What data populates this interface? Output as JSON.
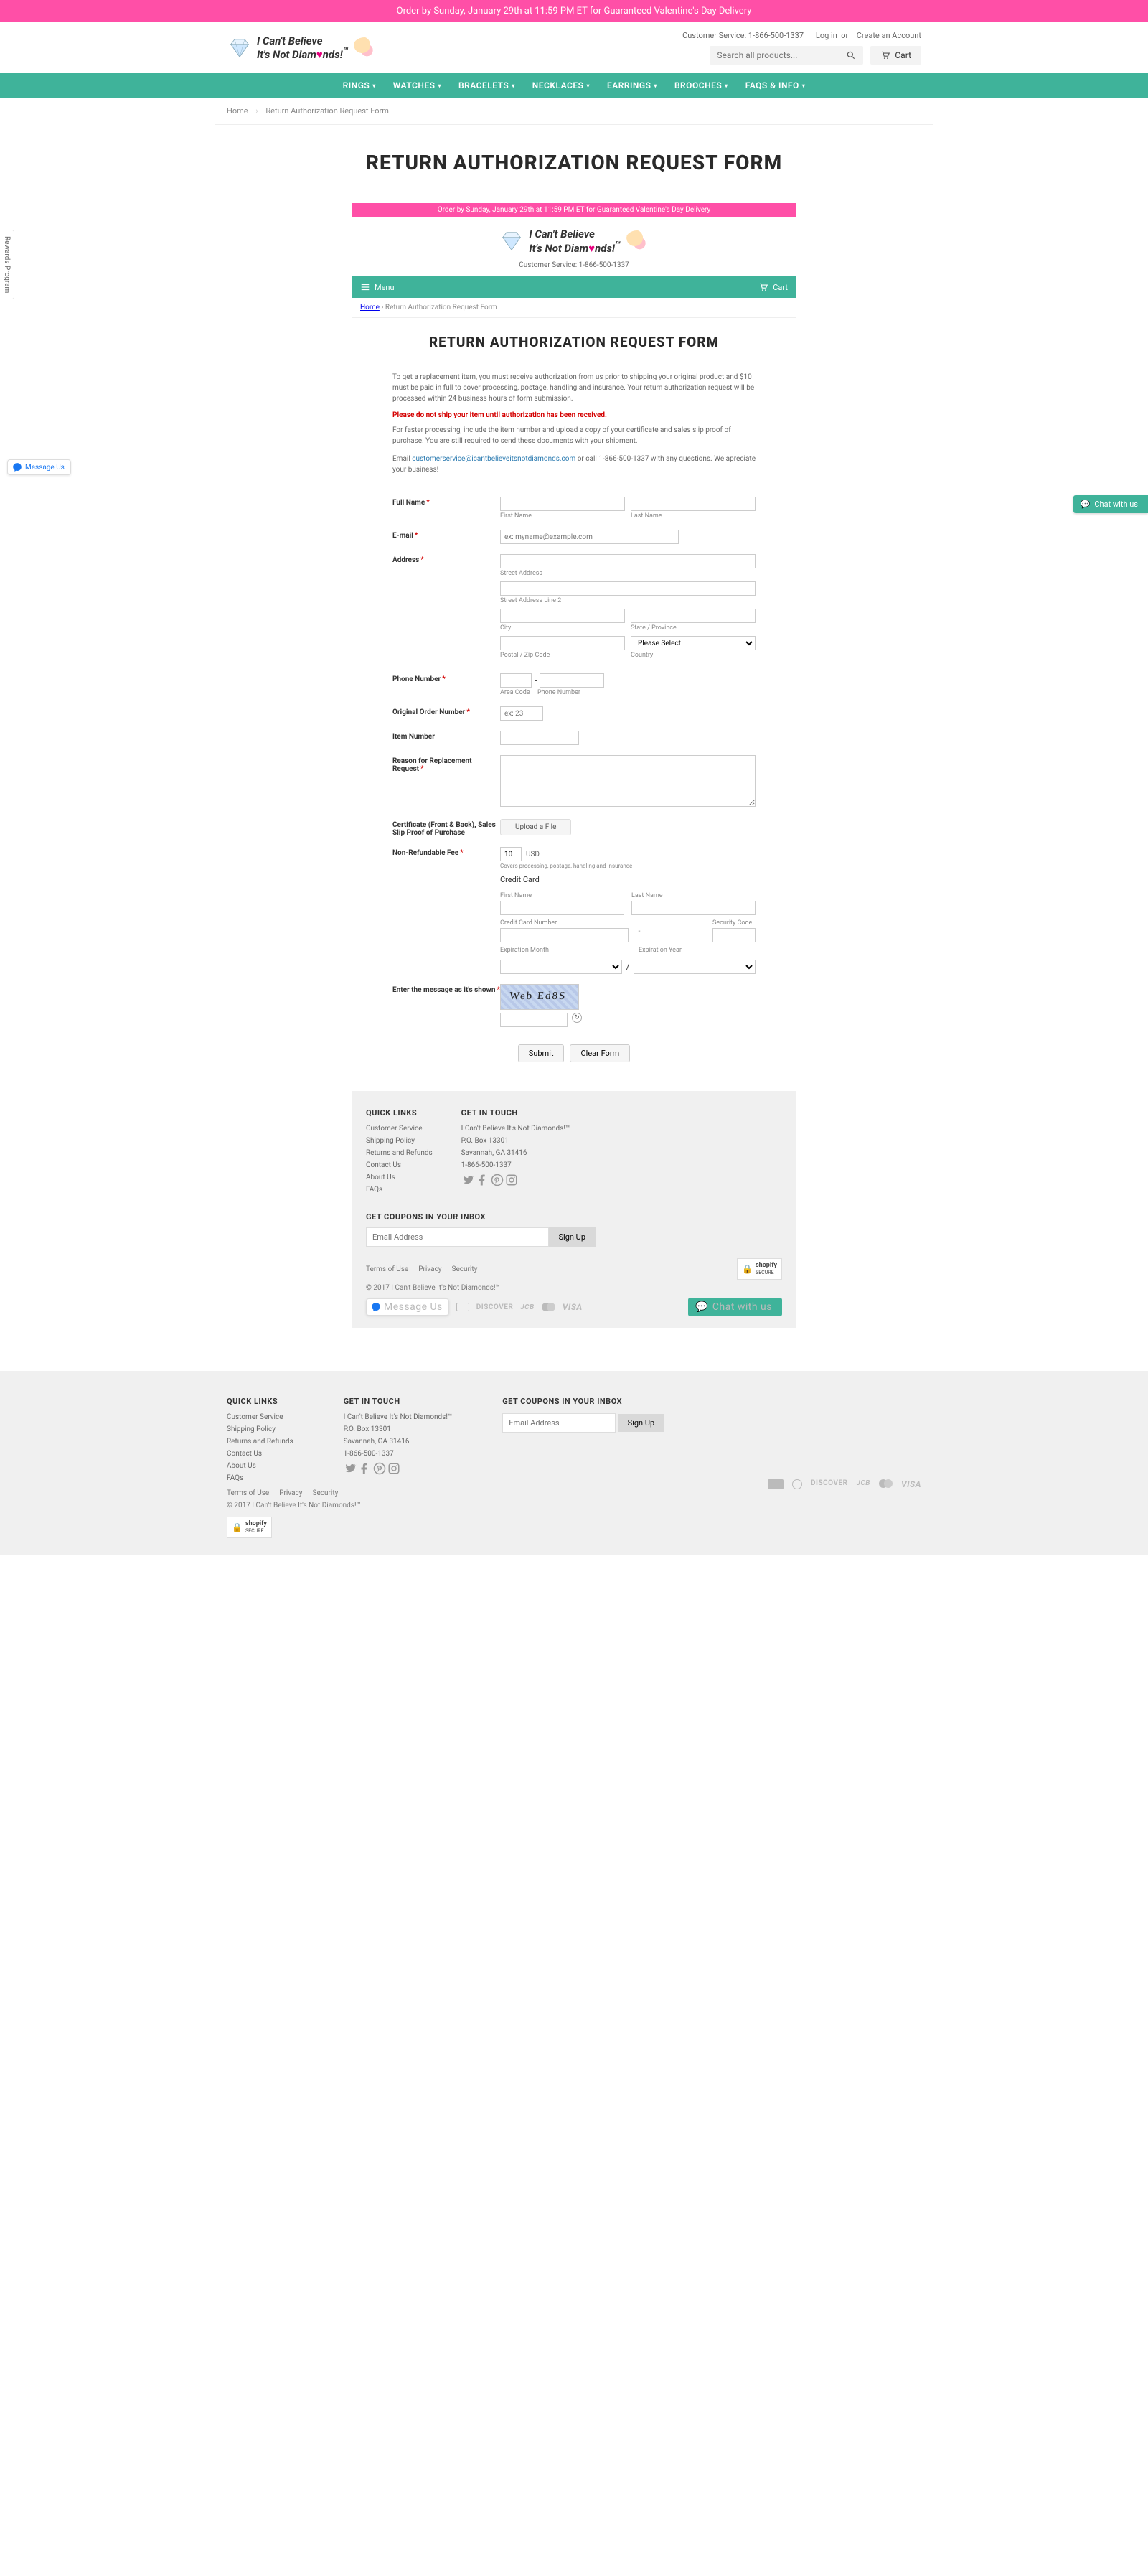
{
  "banner": "Order by Sunday, January 29th at 11:59 PM ET for Guaranteed Valentine's Day Delivery",
  "header": {
    "cs_label": "Customer Service:",
    "cs_phone": "1-866-500-1337",
    "login": "Log in",
    "or": "or",
    "create": "Create an Account",
    "search_placeholder": "Search all products...",
    "cart": "Cart"
  },
  "logo": {
    "line1": "I Can't Believe",
    "line2": "It's Not Diam",
    "line2b": "nds!",
    "tm": "™"
  },
  "nav": [
    "RINGS",
    "WATCHES",
    "BRACELETS",
    "NECKLACES",
    "EARRINGS",
    "BROOCHES",
    "FAQS & INFO"
  ],
  "breadcrumb": {
    "home": "Home",
    "current": "Return Authorization Request Form"
  },
  "title": "RETURN AUTHORIZATION REQUEST FORM",
  "embed": {
    "contact": "Customer Service: 1-866-500-1337",
    "menu": "Menu",
    "cart": "Cart"
  },
  "form": {
    "intro": "To get a replacement item, you must receive authorization from us prior to shipping your original product and $10 must be paid in full to cover processing, postage, handling and insurance.  Your return authorization request will be processed within 24 business hours of form submission.",
    "warn": "Please do not ship your item until authorization has been received.",
    "faster": "For faster processing, include the item number and upload a copy of your certificate and sales slip proof of purchase.  You are still required to send these documents with your shipment.",
    "email_pre": "Email ",
    "email_addr": "customerservice@icantbelieveitsnotdiamonds.com",
    "email_post": " or call 1-866-500-1337 with any questions.  We apreciate your business!",
    "labels": {
      "full_name": "Full Name",
      "first": "First Name",
      "last": "Last Name",
      "email": "E-mail",
      "email_ph": "ex: myname@example.com",
      "address": "Address",
      "street": "Street Address",
      "street2": "Street Address Line 2",
      "city": "City",
      "state": "State / Province",
      "zip": "Postal / Zip Code",
      "country": "Country",
      "country_sel": "Please Select",
      "phone": "Phone Number",
      "area": "Area Code",
      "phno": "Phone Number",
      "order": "Original Order Number",
      "order_ph": "ex: 23",
      "item": "Item Number",
      "reason": "Reason for Replacement Request",
      "cert": "Certificate (Front & Back), Sales Slip Proof of Purchase",
      "upload": "Upload a File",
      "fee": "Non-Refundable Fee",
      "fee_val": "10",
      "fee_cur": "USD",
      "fee_note": "Covers processing, postage, handling and insurance",
      "cc": "Credit Card",
      "ccnum": "Credit Card Number",
      "sec": "Security Code",
      "expm": "Expiration Month",
      "expy": "Expiration Year",
      "dash": "-",
      "slash": "/",
      "captcha": "Enter the message as it's shown",
      "captcha_text": "Web Ed8S",
      "submit": "Submit",
      "clear": "Clear Form"
    }
  },
  "footer": {
    "ql_title": "QUICK LINKS",
    "ql": [
      "Customer Service",
      "Shipping Policy",
      "Returns and Refunds",
      "Contact Us",
      "About Us",
      "FAQs"
    ],
    "git_title": "GET IN TOUCH",
    "addr": [
      "I Can't Believe It's Not Diamonds!™",
      "P.O. Box 13301",
      "Savannah, GA 31416",
      "1-866-500-1337"
    ],
    "coupon_title": "GET COUPONS IN YOUR INBOX",
    "email_ph": "Email Address",
    "signup": "Sign Up",
    "legal": [
      "Terms of Use",
      "Privacy",
      "Security"
    ],
    "copy": "© 2017 I Can't Believe It's Not Diamonds!™",
    "shopify": "shopify",
    "shopify_sub": "SECURE",
    "msg": "Message Us",
    "chat": "Chat with us",
    "rewards": "Rewards Program",
    "pay_inner": [
      "DISCOVER",
      "JCB"
    ],
    "pay_outer": [
      "DISCOVER",
      "JCB"
    ]
  }
}
